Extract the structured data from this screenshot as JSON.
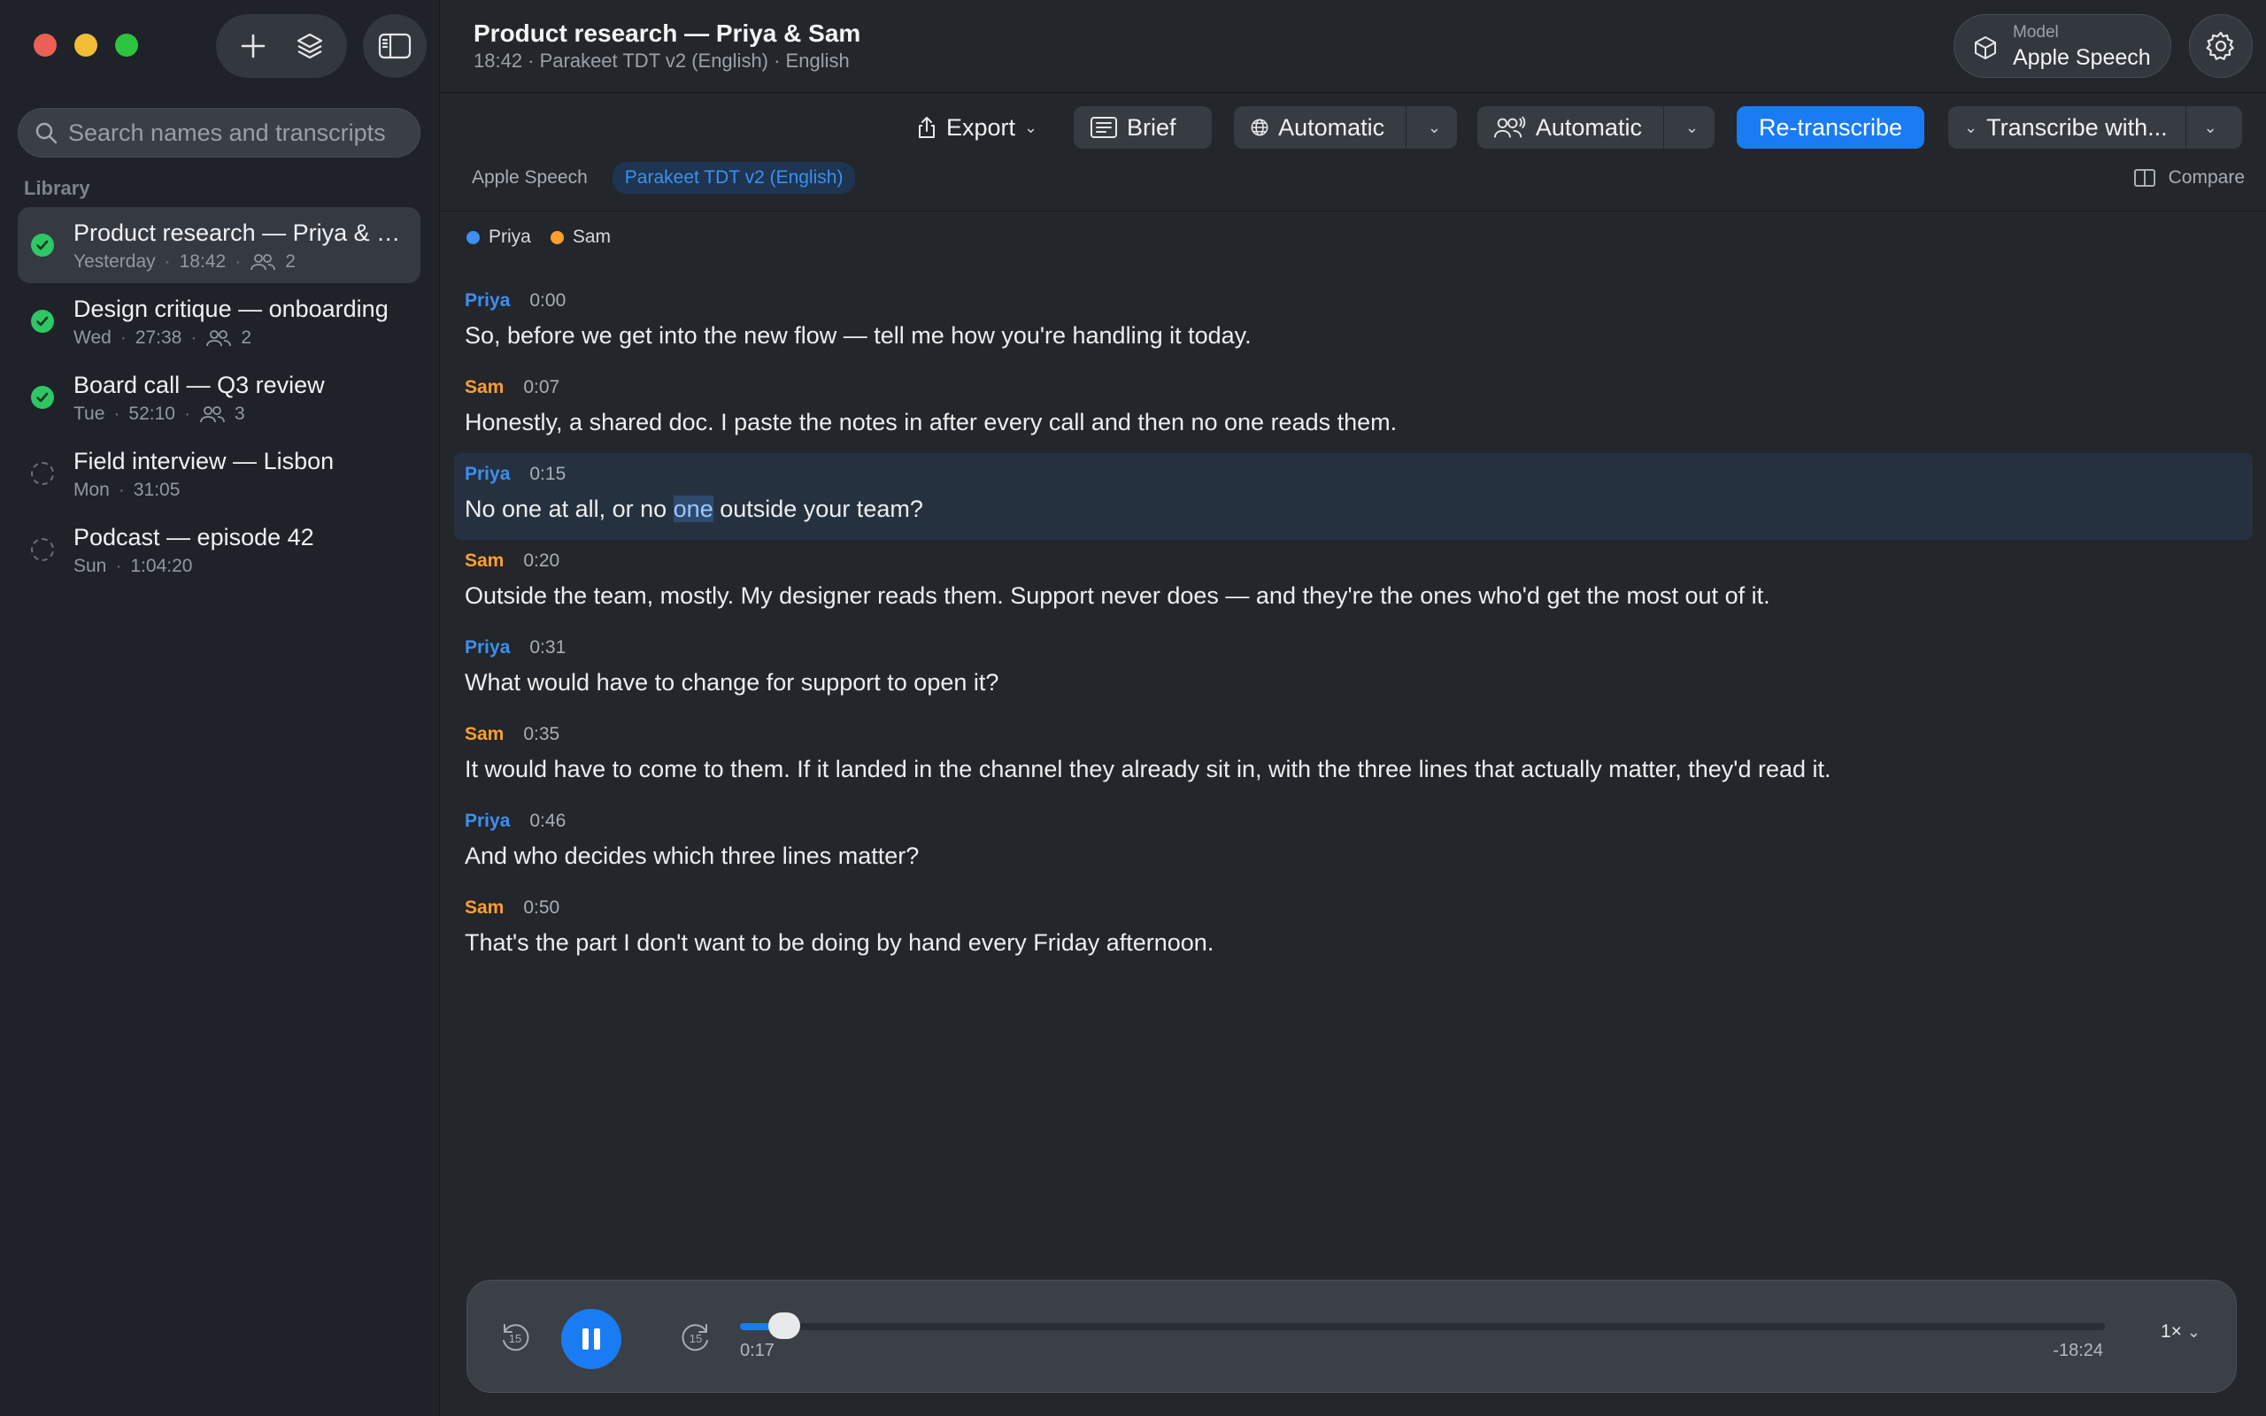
{
  "window": {
    "title": "Product research — Priya & Sam",
    "subtitle": "18:42 · Parakeet TDT v2 (English) · English"
  },
  "sidebar": {
    "search_placeholder": "Search names and transcripts",
    "library_label": "Library",
    "items": [
      {
        "title": "Product research — Priya & S...",
        "day": "Yesterday",
        "duration": "18:42",
        "speakers": "2",
        "status": "done",
        "active": true
      },
      {
        "title": "Design critique — onboarding",
        "day": "Wed",
        "duration": "27:38",
        "speakers": "2",
        "status": "done",
        "active": false
      },
      {
        "title": "Board call — Q3 review",
        "day": "Tue",
        "duration": "52:10",
        "speakers": "3",
        "status": "done",
        "active": false
      },
      {
        "title": "Field interview — Lisbon",
        "day": "Mon",
        "duration": "31:05",
        "speakers": null,
        "status": "pending",
        "active": false
      },
      {
        "title": "Podcast — episode 42",
        "day": "Sun",
        "duration": "1:04:20",
        "speakers": null,
        "status": "pending",
        "active": false
      }
    ]
  },
  "header": {
    "model_label": "Model",
    "model_value": "Apple Speech"
  },
  "toolbar": {
    "export": "Export",
    "brief": "Brief",
    "language": "Automatic",
    "speakers": "Automatic",
    "retranscribe": "Re-transcribe",
    "transcribe_with": "Transcribe with..."
  },
  "model_tabs": [
    {
      "label": "Apple Speech",
      "active": false
    },
    {
      "label": "Parakeet TDT v2 (English)",
      "active": true
    }
  ],
  "compare_label": "Compare",
  "legend": [
    {
      "name": "Priya",
      "color": "#3d8ff0"
    },
    {
      "name": "Sam",
      "color": "#ff9f2e"
    }
  ],
  "transcript": [
    {
      "speaker": "Priya",
      "time": "0:00",
      "text": "So, before we get into the new flow — tell me how you're handling it today."
    },
    {
      "speaker": "Sam",
      "time": "0:07",
      "text": "Honestly, a shared doc. I paste the notes in after every call and then no one reads them."
    },
    {
      "speaker": "Priya",
      "time": "0:15",
      "text_before": "No one at all, or no ",
      "text_highlight": "one",
      "text_after": " outside your team?",
      "highlight": true
    },
    {
      "speaker": "Sam",
      "time": "0:20",
      "text": "Outside the team, mostly. My designer reads them. Support never does — and they're the ones who'd get the most out of it."
    },
    {
      "speaker": "Priya",
      "time": "0:31",
      "text": "What would have to change for support to open it?"
    },
    {
      "speaker": "Sam",
      "time": "0:35",
      "text": "It would have to come to them. If it landed in the channel they already sit in, with the three lines that actually matter, they'd read it."
    },
    {
      "speaker": "Priya",
      "time": "0:46",
      "text": "And who decides which three lines matter?"
    },
    {
      "speaker": "Sam",
      "time": "0:50",
      "text": "That's the part I don't want to be doing by hand every Friday afternoon."
    }
  ],
  "player": {
    "skip_back": "15",
    "skip_fwd": "15",
    "current": "0:17",
    "remaining": "-18:24",
    "progress": 0.0157,
    "speed": "1×"
  }
}
